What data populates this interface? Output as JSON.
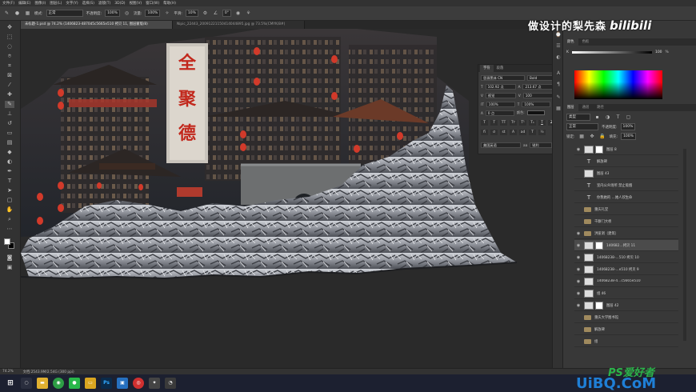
{
  "menu": [
    "文件(F)",
    "编辑(E)",
    "图像(I)",
    "图层(L)",
    "文字(Y)",
    "选择(S)",
    "滤镜(T)",
    "3D(D)",
    "视图(V)",
    "窗口(W)",
    "帮助(H)"
  ],
  "options": {
    "mode_label": "模式:",
    "mode_value": "正常",
    "opacity_label": "不透明度:",
    "opacity_value": "100%",
    "flow_label": "流量:",
    "flow_value": "100%",
    "smooth_label": "平滑:",
    "smooth_value": "10%",
    "angle_value": "0°"
  },
  "tabs": [
    {
      "label": "未标题-1.psd @ 74.2% (1406823-4870d5c5665e510 拷贝 11, 图层蒙版/8)",
      "active": true
    },
    {
      "label": "Nipic_22443_20091221150414044895.jpg @ 73.5%(CMYK/8#)",
      "active": false
    }
  ],
  "char_panel": {
    "tab1": "字符",
    "tab2": "段落",
    "font": "思源黑体 CN",
    "style": "Bold",
    "size": "102.92 点",
    "leading": "213.67 点",
    "kerning": "视觉",
    "tracking": "100",
    "vscale": "100%",
    "hscale": "100%",
    "baseline": "0 点",
    "color_label": "颜色:",
    "lang": "美国英语",
    "aa": "锐利"
  },
  "right": {
    "color_tabs": [
      "颜色",
      "色板"
    ],
    "k_label": "K",
    "k_value": "100",
    "layer_tabs": [
      "图层",
      "通道",
      "路径"
    ],
    "kind": "类型",
    "blend": "正常",
    "opacity_label": "不透明度:",
    "opacity": "100%",
    "lock_label": "锁定:",
    "fill_label": "填充:",
    "fill": "100%"
  },
  "layers": [
    {
      "name": "图层 8",
      "kind": "thumb-mask",
      "selected": false
    },
    {
      "name": "解放碑",
      "kind": "text",
      "selected": false
    },
    {
      "name": "图层 43",
      "kind": "thumb",
      "selected": false
    },
    {
      "name": "室内公众场所 禁止吸烟",
      "kind": "text",
      "selected": false
    },
    {
      "name": "你我她的 …她人欣生命",
      "kind": "text",
      "selected": false
    },
    {
      "name": "重庆礼堂",
      "kind": "folder",
      "selected": false
    },
    {
      "name": "千厮门大桥",
      "kind": "folder",
      "selected": false
    },
    {
      "name": "洪崖洞（建筑）",
      "kind": "folder",
      "selected": false
    },
    {
      "name": "140682…拷贝 11",
      "kind": "thumb-mask",
      "selected": true
    },
    {
      "name": "14068238-…510 拷贝 10",
      "kind": "thumb",
      "selected": false
    },
    {
      "name": "14068238-…e510 拷贝 9",
      "kind": "thumb",
      "selected": false
    },
    {
      "name": "14068238-4…c5665e510",
      "kind": "thumb",
      "selected": false
    },
    {
      "name": "组 46",
      "kind": "thumb",
      "selected": false
    },
    {
      "name": "图层 42",
      "kind": "thumb-mask",
      "selected": false
    },
    {
      "name": "重庆大学图书馆",
      "kind": "folder",
      "selected": false
    },
    {
      "name": "解放碑",
      "kind": "folder",
      "selected": false
    },
    {
      "name": "组",
      "kind": "folder",
      "selected": false
    }
  ],
  "signs": {
    "s1": "全",
    "s2": "聚",
    "s3": "德"
  },
  "status": {
    "zoom": "74.2%",
    "doc": "文档:2543.9M/2.54G (300 ppi)"
  },
  "watermark": {
    "title": "做设计的梨先森",
    "bili": "bilibili",
    "ps": "PS爱好者",
    "uibo": "UiBQ.CoM"
  },
  "taskbar_icons": [
    "start-icon",
    "search-icon",
    "explorer-icon",
    "chrome-icon",
    "wechat-icon",
    "folder-icon",
    "photoshop-icon",
    "app-icon",
    "netease-icon",
    "tool-icon",
    "misc-icon"
  ]
}
